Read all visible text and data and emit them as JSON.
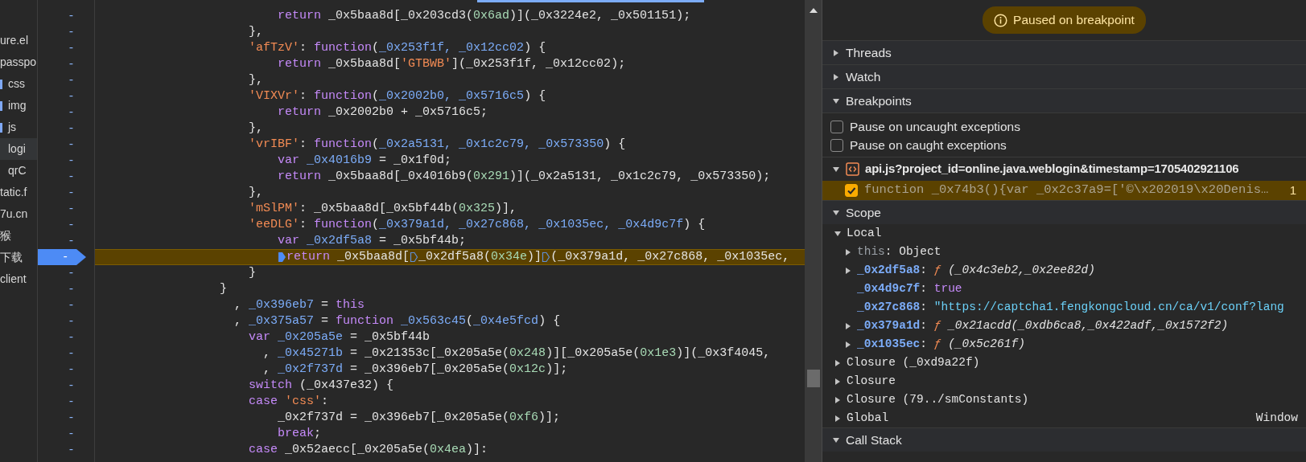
{
  "file_tree": [
    {
      "label": "ure.el",
      "kind": "file",
      "selected": false
    },
    {
      "label": "passpo",
      "kind": "file",
      "selected": false,
      "children": [
        {
          "label": "css",
          "kind": "folder",
          "selected": false
        },
        {
          "label": "img",
          "kind": "folder",
          "selected": false
        },
        {
          "label": "js",
          "kind": "folder",
          "selected": false,
          "children": [
            {
              "label": "logi",
              "kind": "file",
              "selected": true
            },
            {
              "label": "qrC",
              "kind": "file",
              "selected": false
            }
          ]
        }
      ]
    },
    {
      "label": "tatic.f",
      "kind": "file",
      "selected": false
    },
    {
      "label": "7u.cn",
      "kind": "file",
      "selected": false
    },
    {
      "label": "猴",
      "kind": "file",
      "selected": false
    },
    {
      "label": "下载",
      "kind": "file",
      "selected": false
    },
    {
      "label": "client",
      "kind": "file",
      "selected": false
    }
  ],
  "code": {
    "lines": [
      {
        "gutter": "-",
        "breakpoint": false,
        "paused": false,
        "tokens": [
          {
            "kind": "kw",
            "text": "                        return"
          },
          {
            "kind": "plain",
            "text": " _0x5baa8d[_0x203cd3("
          },
          {
            "kind": "num",
            "text": "0x6ad"
          },
          {
            "kind": "plain",
            "text": ")](_0x3224e2, _0x501151);"
          }
        ]
      },
      {
        "gutter": "-",
        "breakpoint": false,
        "paused": false,
        "tokens": [
          {
            "kind": "plain",
            "text": "                    },"
          }
        ]
      },
      {
        "gutter": "-",
        "breakpoint": false,
        "paused": false,
        "tokens": [
          {
            "kind": "str",
            "text": "                    'afTzV'"
          },
          {
            "kind": "plain",
            "text": ": "
          },
          {
            "kind": "kw",
            "text": "function"
          },
          {
            "kind": "plain",
            "text": "("
          },
          {
            "kind": "def",
            "text": "_0x253f1f, _0x12cc02"
          },
          {
            "kind": "plain",
            "text": ") {"
          }
        ]
      },
      {
        "gutter": "-",
        "breakpoint": false,
        "paused": false,
        "tokens": [
          {
            "kind": "kw",
            "text": "                        return"
          },
          {
            "kind": "plain",
            "text": " _0x5baa8d["
          },
          {
            "kind": "str",
            "text": "'GTBWB'"
          },
          {
            "kind": "plain",
            "text": "](_0x253f1f, _0x12cc02);"
          }
        ]
      },
      {
        "gutter": "-",
        "breakpoint": false,
        "paused": false,
        "tokens": [
          {
            "kind": "plain",
            "text": "                    },"
          }
        ]
      },
      {
        "gutter": "-",
        "breakpoint": false,
        "paused": false,
        "tokens": [
          {
            "kind": "str",
            "text": "                    'VIXVr'"
          },
          {
            "kind": "plain",
            "text": ": "
          },
          {
            "kind": "kw",
            "text": "function"
          },
          {
            "kind": "plain",
            "text": "("
          },
          {
            "kind": "def",
            "text": "_0x2002b0, _0x5716c5"
          },
          {
            "kind": "plain",
            "text": ") {"
          }
        ]
      },
      {
        "gutter": "-",
        "breakpoint": false,
        "paused": false,
        "tokens": [
          {
            "kind": "kw",
            "text": "                        return"
          },
          {
            "kind": "plain",
            "text": " _0x2002b0 + _0x5716c5;"
          }
        ]
      },
      {
        "gutter": "-",
        "breakpoint": false,
        "paused": false,
        "tokens": [
          {
            "kind": "plain",
            "text": "                    },"
          }
        ]
      },
      {
        "gutter": "-",
        "breakpoint": false,
        "paused": false,
        "tokens": [
          {
            "kind": "str",
            "text": "                    'vrIBF'"
          },
          {
            "kind": "plain",
            "text": ": "
          },
          {
            "kind": "kw",
            "text": "function"
          },
          {
            "kind": "plain",
            "text": "("
          },
          {
            "kind": "def",
            "text": "_0x2a5131, _0x1c2c79, _0x573350"
          },
          {
            "kind": "plain",
            "text": ") {"
          }
        ]
      },
      {
        "gutter": "-",
        "breakpoint": false,
        "paused": false,
        "tokens": [
          {
            "kind": "kw",
            "text": "                        var "
          },
          {
            "kind": "def",
            "text": "_0x4016b9"
          },
          {
            "kind": "plain",
            "text": " = _0x1f0d;"
          }
        ]
      },
      {
        "gutter": "-",
        "breakpoint": false,
        "paused": false,
        "tokens": [
          {
            "kind": "kw",
            "text": "                        return"
          },
          {
            "kind": "plain",
            "text": " _0x5baa8d[_0x4016b9("
          },
          {
            "kind": "num",
            "text": "0x291"
          },
          {
            "kind": "plain",
            "text": ")](_0x2a5131, _0x1c2c79, _0x573350);"
          }
        ]
      },
      {
        "gutter": "-",
        "breakpoint": false,
        "paused": false,
        "tokens": [
          {
            "kind": "plain",
            "text": "                    },"
          }
        ]
      },
      {
        "gutter": "-",
        "breakpoint": false,
        "paused": false,
        "tokens": [
          {
            "kind": "str",
            "text": "                    'mSlPM'"
          },
          {
            "kind": "plain",
            "text": ": _0x5baa8d[_0x5bf44b("
          },
          {
            "kind": "num",
            "text": "0x325"
          },
          {
            "kind": "plain",
            "text": ")],"
          }
        ]
      },
      {
        "gutter": "-",
        "breakpoint": false,
        "paused": false,
        "tokens": [
          {
            "kind": "str",
            "text": "                    'eeDLG'"
          },
          {
            "kind": "plain",
            "text": ": "
          },
          {
            "kind": "kw",
            "text": "function"
          },
          {
            "kind": "plain",
            "text": "("
          },
          {
            "kind": "def",
            "text": "_0x379a1d, _0x27c868, _0x1035ec, _0x4d9c7f"
          },
          {
            "kind": "plain",
            "text": ") {"
          }
        ]
      },
      {
        "gutter": "-",
        "breakpoint": false,
        "paused": false,
        "tokens": [
          {
            "kind": "kw",
            "text": "                        var "
          },
          {
            "kind": "def",
            "text": "_0x2df5a8"
          },
          {
            "kind": "plain",
            "text": " = _0x5bf44b;"
          }
        ]
      },
      {
        "gutter": "-",
        "breakpoint": true,
        "paused": true,
        "tokens": [
          {
            "kind": "marker",
            "active": true
          },
          {
            "kind": "kw",
            "text": "return"
          },
          {
            "kind": "plain",
            "text": " _0x5baa8d["
          },
          {
            "kind": "marker",
            "active": false
          },
          {
            "kind": "plain",
            "text": "_0x2df5a8("
          },
          {
            "kind": "num",
            "text": "0x34e"
          },
          {
            "kind": "plain",
            "text": ")]"
          },
          {
            "kind": "marker",
            "active": false
          },
          {
            "kind": "plain",
            "text": "(_0x379a1d, _0x27c868, _0x1035ec,"
          }
        ]
      },
      {
        "gutter": "-",
        "breakpoint": false,
        "paused": false,
        "tokens": [
          {
            "kind": "plain",
            "text": "                    }"
          }
        ]
      },
      {
        "gutter": "-",
        "breakpoint": false,
        "paused": false,
        "tokens": [
          {
            "kind": "plain",
            "text": "                }"
          }
        ]
      },
      {
        "gutter": "-",
        "breakpoint": false,
        "paused": false,
        "tokens": [
          {
            "kind": "plain",
            "text": "                  , "
          },
          {
            "kind": "def",
            "text": "_0x396eb7"
          },
          {
            "kind": "plain",
            "text": " = "
          },
          {
            "kind": "kw",
            "text": "this"
          }
        ]
      },
      {
        "gutter": "-",
        "breakpoint": false,
        "paused": false,
        "tokens": [
          {
            "kind": "plain",
            "text": "                  , "
          },
          {
            "kind": "def",
            "text": "_0x375a57"
          },
          {
            "kind": "plain",
            "text": " = "
          },
          {
            "kind": "kw",
            "text": "function "
          },
          {
            "kind": "def",
            "text": "_0x563c45"
          },
          {
            "kind": "plain",
            "text": "("
          },
          {
            "kind": "def",
            "text": "_0x4e5fcd"
          },
          {
            "kind": "plain",
            "text": ") {"
          }
        ]
      },
      {
        "gutter": "-",
        "breakpoint": false,
        "paused": false,
        "tokens": [
          {
            "kind": "kw",
            "text": "                    var "
          },
          {
            "kind": "def",
            "text": "_0x205a5e"
          },
          {
            "kind": "plain",
            "text": " = _0x5bf44b"
          }
        ]
      },
      {
        "gutter": "-",
        "breakpoint": false,
        "paused": false,
        "tokens": [
          {
            "kind": "plain",
            "text": "                      , "
          },
          {
            "kind": "def",
            "text": "_0x45271b"
          },
          {
            "kind": "plain",
            "text": " = _0x21353c[_0x205a5e("
          },
          {
            "kind": "num",
            "text": "0x248"
          },
          {
            "kind": "plain",
            "text": ")][_0x205a5e("
          },
          {
            "kind": "num",
            "text": "0x1e3"
          },
          {
            "kind": "plain",
            "text": ")](_0x3f4045,"
          }
        ]
      },
      {
        "gutter": "-",
        "breakpoint": false,
        "paused": false,
        "tokens": [
          {
            "kind": "plain",
            "text": "                      , "
          },
          {
            "kind": "def",
            "text": "_0x2f737d"
          },
          {
            "kind": "plain",
            "text": " = _0x396eb7[_0x205a5e("
          },
          {
            "kind": "num",
            "text": "0x12c"
          },
          {
            "kind": "plain",
            "text": ")];"
          }
        ]
      },
      {
        "gutter": "-",
        "breakpoint": false,
        "paused": false,
        "tokens": [
          {
            "kind": "kw",
            "text": "                    switch"
          },
          {
            "kind": "plain",
            "text": " (_0x437e32) {"
          }
        ]
      },
      {
        "gutter": "-",
        "breakpoint": false,
        "paused": false,
        "tokens": [
          {
            "kind": "kw",
            "text": "                    case "
          },
          {
            "kind": "str",
            "text": "'css'"
          },
          {
            "kind": "plain",
            "text": ":"
          }
        ]
      },
      {
        "gutter": "-",
        "breakpoint": false,
        "paused": false,
        "tokens": [
          {
            "kind": "plain",
            "text": "                        _0x2f737d = _0x396eb7[_0x205a5e("
          },
          {
            "kind": "num",
            "text": "0xf6"
          },
          {
            "kind": "plain",
            "text": ")];"
          }
        ]
      },
      {
        "gutter": "-",
        "breakpoint": false,
        "paused": false,
        "tokens": [
          {
            "kind": "kw",
            "text": "                        break"
          },
          {
            "kind": "plain",
            "text": ";"
          }
        ]
      },
      {
        "gutter": "-",
        "breakpoint": false,
        "paused": false,
        "tokens": [
          {
            "kind": "kw",
            "text": "                    case"
          },
          {
            "kind": "plain",
            "text": " _0x52aecc[_0x205a5e("
          },
          {
            "kind": "num",
            "text": "0x4ea"
          },
          {
            "kind": "plain",
            "text": ")]:"
          }
        ]
      }
    ]
  },
  "debugger": {
    "status": "Paused on breakpoint",
    "sections": [
      {
        "title": "Threads",
        "expanded": false
      },
      {
        "title": "Watch",
        "expanded": false
      },
      {
        "title": "Breakpoints",
        "expanded": true,
        "options": [
          {
            "label": "Pause on uncaught exceptions",
            "checked": false
          },
          {
            "label": "Pause on caught exceptions",
            "checked": false
          }
        ],
        "files": [
          {
            "name": "api.js?project_id=online.java.weblogin&timestamp=1705402921106",
            "expanded": true,
            "breakpoints": [
              {
                "code": "function _0x74b3(){var _0x2c37a9=['©\\x202019\\x20Denis…",
                "checked": true,
                "count": "1"
              }
            ]
          }
        ]
      },
      {
        "title": "Scope",
        "expanded": true,
        "scopes": [
          {
            "label": "Local",
            "expanded": true,
            "properties": [
              {
                "name": "this",
                "separator": ":",
                "dimmed": true,
                "expandable": true,
                "kind": "object",
                "value": "Object"
              },
              {
                "name": "_0x2df5a8",
                "separator": ":",
                "dimmed": false,
                "expandable": true,
                "kind": "function",
                "marker": "ƒ",
                "value": "(_0x4c3eb2,_0x2ee82d)"
              },
              {
                "name": "_0x4d9c7f",
                "separator": ":",
                "dimmed": false,
                "expandable": false,
                "kind": "boolean",
                "value": "true"
              },
              {
                "name": "_0x27c868",
                "separator": ":",
                "dimmed": false,
                "expandable": false,
                "kind": "string",
                "value": "\"https://captcha1.fengkongcloud.cn/ca/v1/conf?lang"
              },
              {
                "name": "_0x379a1d",
                "separator": ":",
                "dimmed": false,
                "expandable": true,
                "kind": "function",
                "marker": "ƒ",
                "value": "_0x21acdd(_0xdb6ca8,_0x422adf,_0x1572f2)"
              },
              {
                "name": "_0x1035ec",
                "separator": ":",
                "dimmed": false,
                "expandable": true,
                "kind": "function",
                "marker": "ƒ",
                "value": "(_0x5c261f)"
              }
            ]
          },
          {
            "label": "Closure (_0xd9a22f)",
            "expanded": false
          },
          {
            "label": "Closure",
            "expanded": false
          },
          {
            "label": "Closure (79../smConstants)",
            "expanded": false
          },
          {
            "label": "Global",
            "expanded": false,
            "value": "Window"
          }
        ]
      },
      {
        "title": "Call Stack",
        "expanded": true
      }
    ]
  }
}
